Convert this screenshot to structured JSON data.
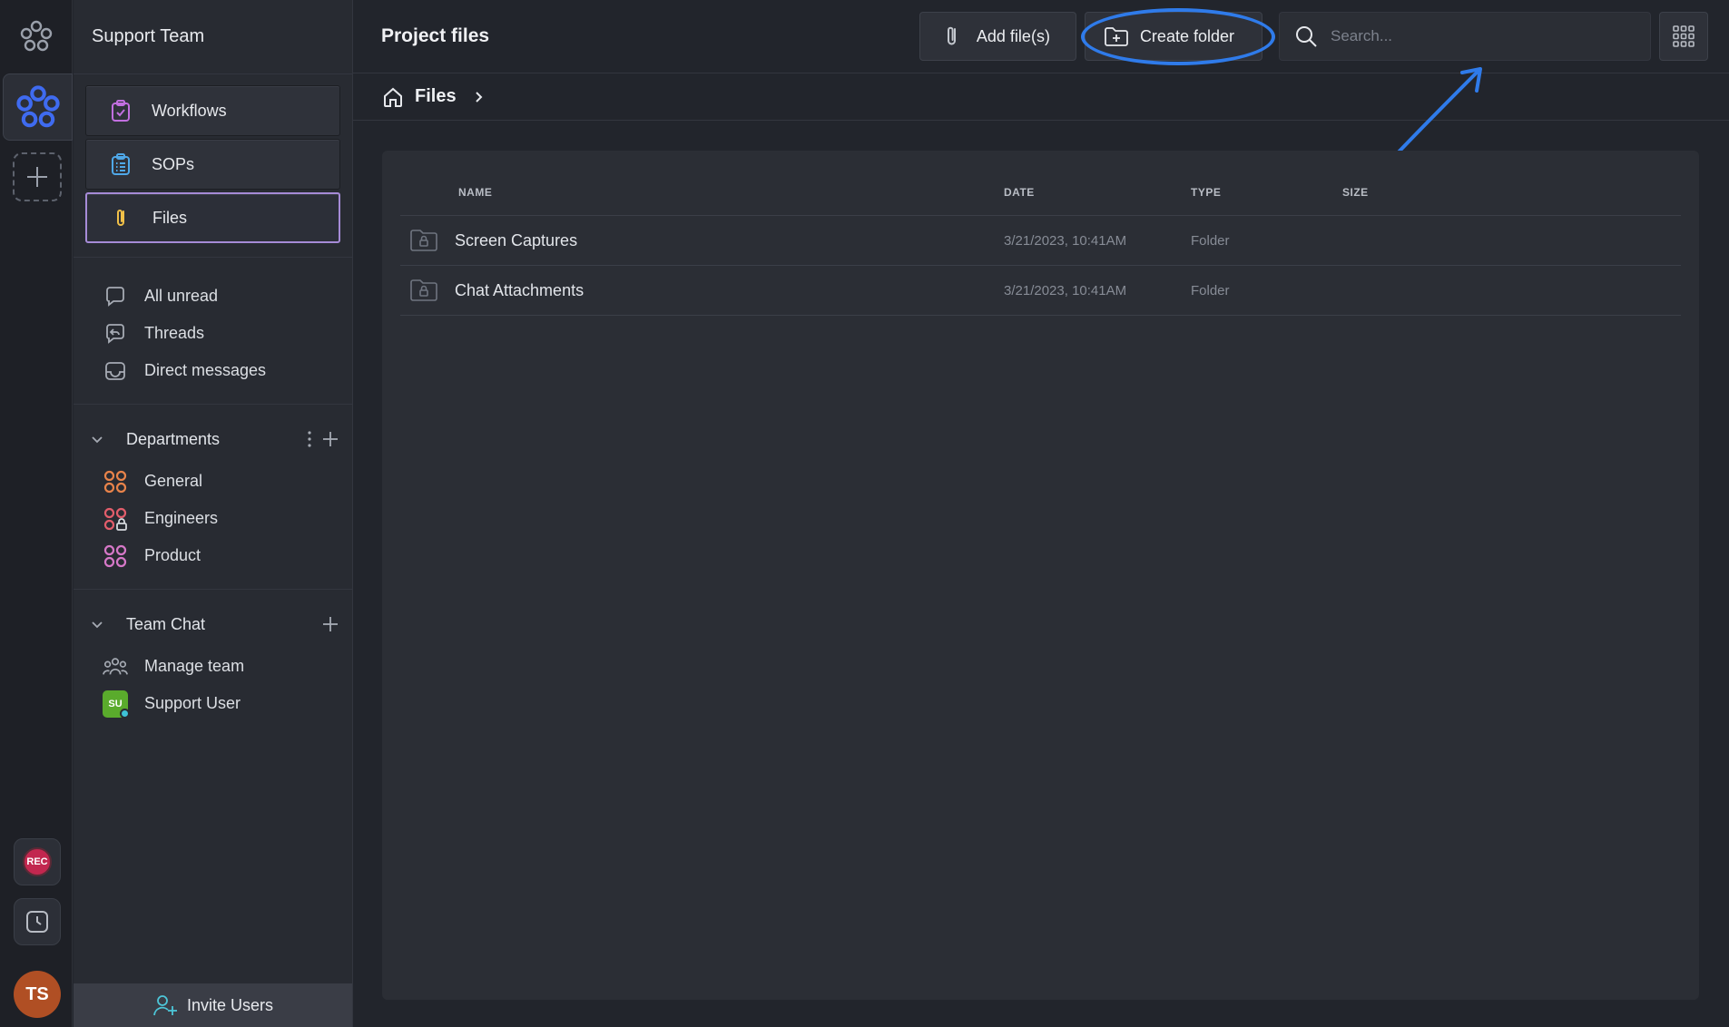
{
  "workspace": {
    "name": "Support Team"
  },
  "sidebar": {
    "primary": [
      {
        "label": "Workflows",
        "icon": "clipboard-check-icon",
        "active": false
      },
      {
        "label": "SOPs",
        "icon": "clipboard-list-icon",
        "active": false
      },
      {
        "label": "Files",
        "icon": "paperclip-icon",
        "active": true
      }
    ],
    "inbox": [
      {
        "label": "All unread",
        "icon": "chat-bubble-icon"
      },
      {
        "label": "Threads",
        "icon": "thread-reply-icon"
      },
      {
        "label": "Direct messages",
        "icon": "inbox-icon"
      }
    ],
    "departments": {
      "title": "Departments",
      "items": [
        {
          "label": "General",
          "icon": "channel-grid-icon",
          "color": "#e8834a"
        },
        {
          "label": "Engineers",
          "icon": "channel-grid-lock-icon",
          "color": "#e25d6b"
        },
        {
          "label": "Product",
          "icon": "channel-grid-icon",
          "color": "#d678c8"
        }
      ]
    },
    "team_chat": {
      "title": "Team Chat",
      "items": [
        {
          "label": "Manage team",
          "icon": "team-icon"
        },
        {
          "label": "Support User",
          "badge": "SU",
          "badge_color": "#5aab2c"
        }
      ]
    },
    "invite": {
      "label": "Invite Users"
    }
  },
  "rail": {
    "rec_label": "REC",
    "user_initials": "TS"
  },
  "main": {
    "title": "Project files",
    "add_files_label": "Add file(s)",
    "create_folder_label": "Create folder",
    "search_placeholder": "Search...",
    "breadcrumb": "Files",
    "accent_color": "#2f7bea"
  },
  "table": {
    "columns": [
      "NAME",
      "DATE",
      "TYPE",
      "SIZE"
    ],
    "rows": [
      {
        "name": "Screen Captures",
        "date": "3/21/2023, 10:41AM",
        "type": "Folder",
        "size": ""
      },
      {
        "name": "Chat Attachments",
        "date": "3/21/2023, 10:41AM",
        "type": "Folder",
        "size": ""
      }
    ]
  }
}
